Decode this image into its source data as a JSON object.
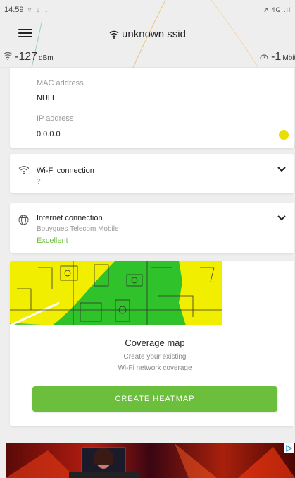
{
  "status_bar": {
    "time": "14:59",
    "indicators": "▿ ↓ ↓ ·",
    "right_icons": "↗ 4G .ıl"
  },
  "header": {
    "title": "unknown ssid",
    "menu_icon": "hamburger-menu-icon",
    "wifi_icon": "wifi-icon"
  },
  "signal": {
    "strength_value": "-127",
    "strength_unit": "dBm",
    "speed_value": "-1",
    "speed_unit": "Mbit/"
  },
  "network_info": {
    "mac_label": "MAC address",
    "mac_value": "NULL",
    "ip_label": "IP address",
    "ip_value": "0.0.0.0",
    "indicator_color": "#e8e000"
  },
  "wifi_connection": {
    "title": "Wi-Fi connection",
    "status": "?",
    "status_color": "#6cbf3c"
  },
  "internet_connection": {
    "title": "Internet connection",
    "provider": "Bouygues Telecom Mobile",
    "quality": "Excellent",
    "quality_color": "#6cbf3c"
  },
  "coverage": {
    "title": "Coverage map",
    "subtitle_line1": "Create your existing",
    "subtitle_line2": "Wi-Fi network coverage",
    "button_label": "CREATE HEATMAP",
    "button_color": "#6cbf3c"
  },
  "ad": {
    "play_icon": "ad-choices-icon"
  }
}
